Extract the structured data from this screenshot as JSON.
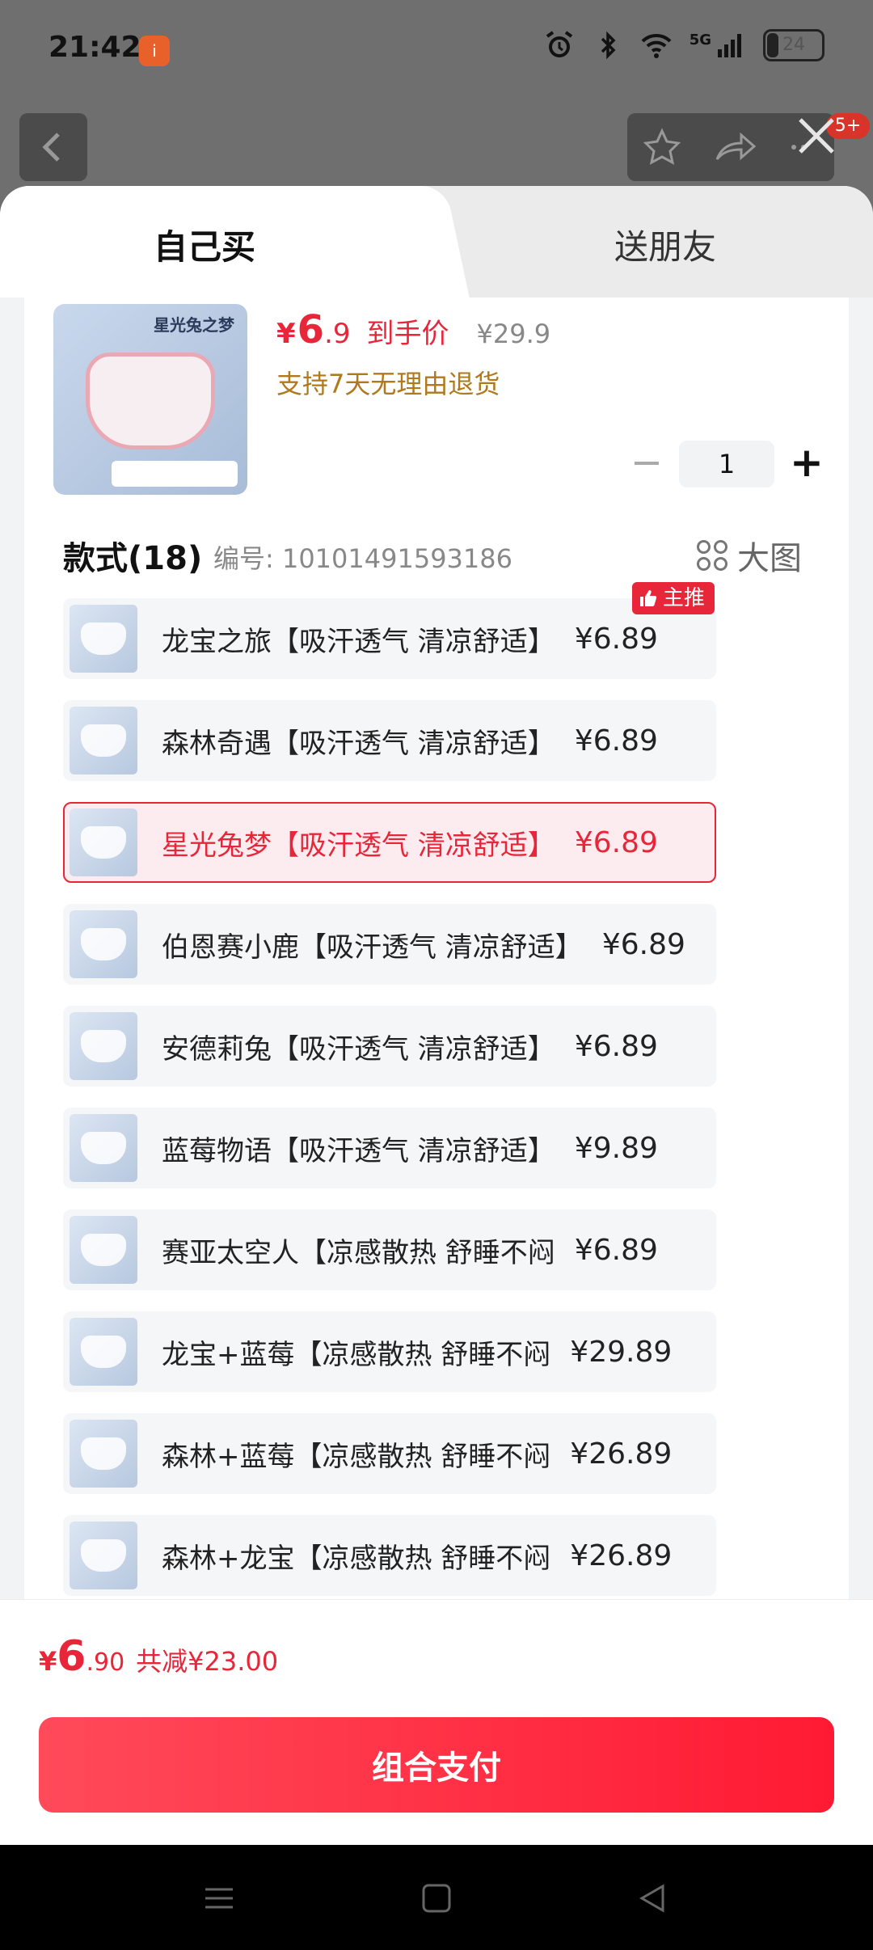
{
  "status_bar": {
    "time": "21:42",
    "app_badge": "i",
    "network": "5G",
    "battery": "24"
  },
  "background": {
    "notification_badge": "5+"
  },
  "tabs": {
    "self": "自己买",
    "friend": "送朋友"
  },
  "product": {
    "image_title": "星光兔之梦",
    "price_symbol": "¥",
    "price_int": "6",
    "price_dec": ".9",
    "price_label": "到手价",
    "original_price": "¥29.9",
    "return_policy": "支持7天无理由退货",
    "quantity": "1"
  },
  "styles": {
    "heading": "款式(18)",
    "code": "编号: 10101491593186",
    "big_pic_label": "大图",
    "main_tag": "主推",
    "items": [
      {
        "name": "龙宝之旅【吸汗透气 清凉舒适】",
        "price": "¥6.89",
        "selected": false,
        "main": true
      },
      {
        "name": "森林奇遇【吸汗透气 清凉舒适】",
        "price": "¥6.89",
        "selected": false
      },
      {
        "name": "星光兔梦【吸汗透气 清凉舒适】",
        "price": "¥6.89",
        "selected": true
      },
      {
        "name": "伯恩赛小鹿【吸汗透气 清凉舒适】",
        "price": "¥6.89",
        "selected": false
      },
      {
        "name": "安德莉兔【吸汗透气 清凉舒适】",
        "price": "¥6.89",
        "selected": false
      },
      {
        "name": "蓝莓物语【吸汗透气 清凉舒适】",
        "price": "¥9.89",
        "selected": false
      },
      {
        "name": "赛亚太空人【凉感散热 舒睡不闷",
        "price": "¥6.89",
        "selected": false
      },
      {
        "name": "龙宝+蓝莓【凉感散热 舒睡不闷",
        "price": "¥29.89",
        "selected": false
      },
      {
        "name": "森林+蓝莓【凉感散热 舒睡不闷",
        "price": "¥26.89",
        "selected": false
      },
      {
        "name": "森林+龙宝【凉感散热 舒睡不闷",
        "price": "¥26.89",
        "selected": false
      }
    ]
  },
  "summary": {
    "symbol": "¥",
    "int": "6",
    "dec": ".90",
    "savings": "共减¥23.00"
  },
  "pay_button": "组合支付",
  "colors": {
    "accent": "#e8263a",
    "return_text": "#b07a1c",
    "pay_start": "#ff4a5a",
    "pay_end": "#ff1a33"
  }
}
